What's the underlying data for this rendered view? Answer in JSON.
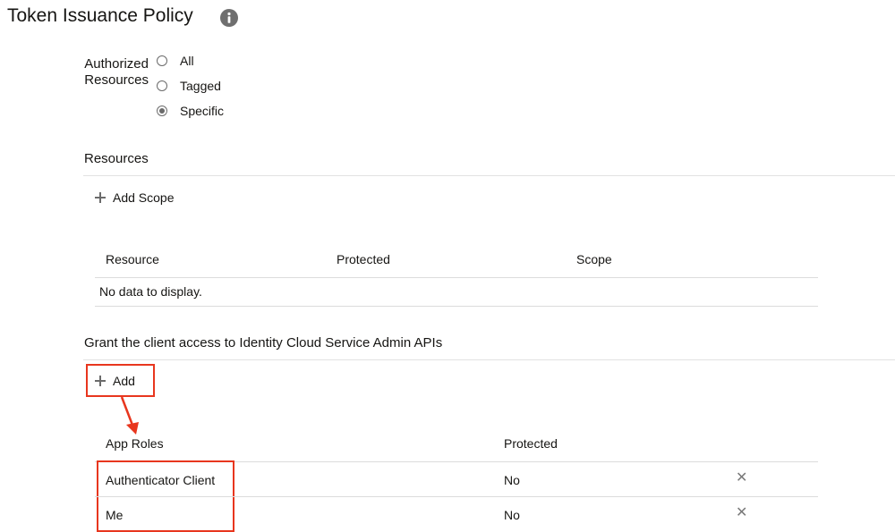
{
  "header": {
    "title": "Token Issuance Policy",
    "info_icon": "info-icon"
  },
  "authorized_resources": {
    "label_line1": "Authorized",
    "label_line2": "Resources",
    "options": [
      {
        "label": "All",
        "selected": false
      },
      {
        "label": "Tagged",
        "selected": false
      },
      {
        "label": "Specific",
        "selected": true
      }
    ]
  },
  "resources": {
    "title": "Resources",
    "add_scope_label": "Add Scope",
    "columns": [
      "Resource",
      "Protected",
      "Scope"
    ],
    "empty_text": "No data to display."
  },
  "admin_apis": {
    "title": "Grant the client access to Identity Cloud Service Admin APIs",
    "add_label": "Add",
    "columns": [
      "App Roles",
      "Protected"
    ],
    "rows": [
      {
        "role": "Authenticator Client",
        "protected": "No"
      },
      {
        "role": "Me",
        "protected": "No"
      }
    ]
  },
  "annotations": {
    "highlight_color": "#e8361e"
  }
}
